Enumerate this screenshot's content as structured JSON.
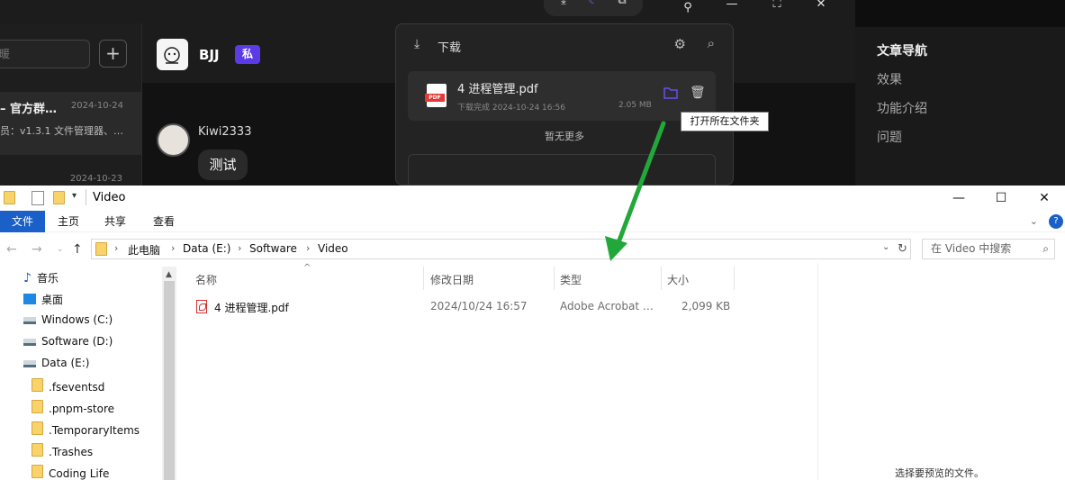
{
  "chat": {
    "left_panel": {
      "search_placeholder": "暖",
      "plus_label": "+",
      "conversations": [
        {
          "title": "– 官方群…",
          "date": "2024-10-24",
          "subtitle": "员：v1.3.1 文件管理器、…"
        },
        {
          "date": "2024-10-23"
        }
      ]
    },
    "header": {
      "name": "BJJ",
      "badge": "私"
    },
    "message": {
      "sender": "Kiwi2333",
      "text": "测试"
    },
    "right_nav": {
      "title": "文章导航",
      "items": [
        "效果",
        "功能介绍",
        "问题"
      ]
    },
    "window_controls": {
      "minimize": "—",
      "maximize": "⛶",
      "close": "✕"
    },
    "toolbar_icons": [
      "download-icon",
      "moon-icon",
      "screenshot-icon",
      "pin-icon"
    ]
  },
  "download_popup": {
    "title": "下载",
    "item": {
      "filename": "4 进程管理.pdf",
      "status": "下载完成 2024-10-24 16:56",
      "size": "2.05 MB",
      "thumb_label": "PDF"
    },
    "empty_text": "暂无更多",
    "tooltip": "打开所在文件夹"
  },
  "explorer": {
    "title": "Video",
    "ribbon_tabs": [
      "文件",
      "主页",
      "共享",
      "查看"
    ],
    "breadcrumb": [
      "此电脑",
      "Data (E:)",
      "Software",
      "Video"
    ],
    "search_placeholder": "在 Video 中搜索",
    "sidebar": [
      {
        "label": "音乐",
        "icon": "music-icon"
      },
      {
        "label": "桌面",
        "icon": "desktop-icon"
      },
      {
        "label": "Windows (C:)",
        "icon": "drive-icon"
      },
      {
        "label": "Software (D:)",
        "icon": "drive-icon"
      },
      {
        "label": "Data (E:)",
        "icon": "drive-icon"
      },
      {
        "label": ".fseventsd",
        "icon": "folder-icon"
      },
      {
        "label": ".pnpm-store",
        "icon": "folder-icon"
      },
      {
        "label": ".TemporaryItems",
        "icon": "folder-icon"
      },
      {
        "label": ".Trashes",
        "icon": "folder-icon"
      },
      {
        "label": "Coding Life",
        "icon": "folder-icon"
      }
    ],
    "columns": [
      "名称",
      "修改日期",
      "类型",
      "大小"
    ],
    "files": [
      {
        "name": "4 进程管理.pdf",
        "modified": "2024/10/24 16:57",
        "type": "Adobe Acrobat …",
        "size": "2,099 KB"
      }
    ],
    "preview_text": "选择要预览的文件。"
  },
  "colors": {
    "accent": "#5b3be6",
    "arrow": "#22a83a",
    "ribbon_file": "#1a60c8"
  }
}
